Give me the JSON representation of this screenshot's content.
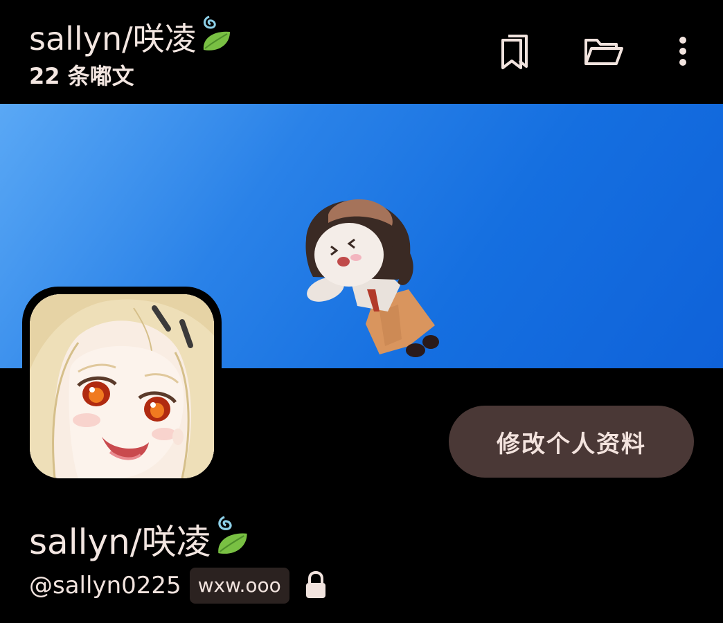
{
  "header": {
    "title": "sallyn/咲凌",
    "post_count": "22 条嘟文",
    "icons": [
      "bookmark-icon",
      "folder-icon",
      "more-vert-icon"
    ]
  },
  "profile": {
    "display_name": "sallyn/咲凌",
    "handle": "@sallyn0225",
    "domain": "wxw.ooo",
    "edit_label": "修改个人资料",
    "locked_icon": "lock-icon",
    "name_emoji": "leaf-emoji"
  },
  "colors": {
    "background": "#000000",
    "text": "#f3e6e1",
    "button_bg": "#4a3836",
    "badge_bg": "#2b2220",
    "banner_sky": "#156fe0"
  }
}
